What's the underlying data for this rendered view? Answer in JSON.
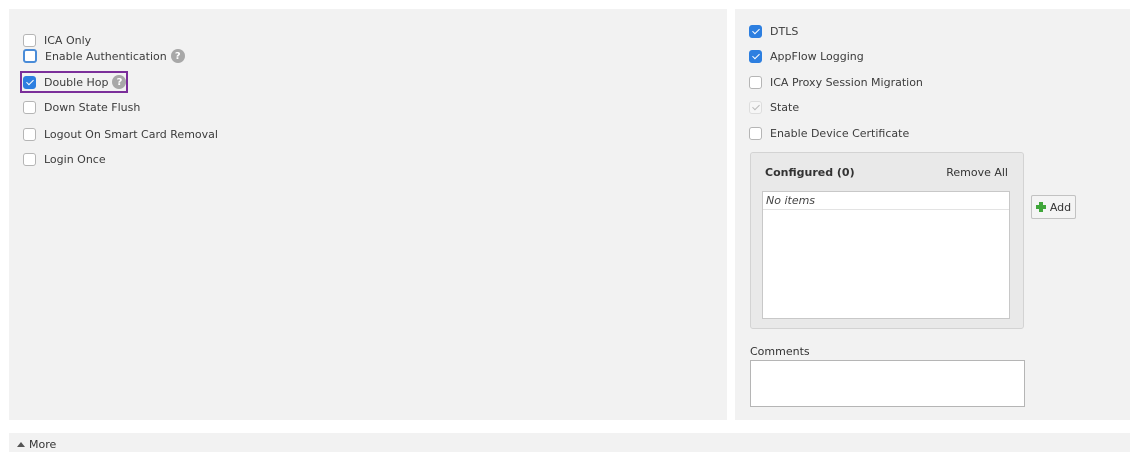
{
  "left_options": [
    {
      "label": "ICA Only",
      "checked": false,
      "help": false,
      "focused": false
    },
    {
      "label": "Enable Authentication",
      "checked": false,
      "help": true,
      "focused": true
    },
    {
      "label": "Double Hop",
      "checked": true,
      "help": true,
      "focused": false,
      "highlighted": true
    },
    {
      "label": "Down State Flush",
      "checked": false,
      "help": false,
      "focused": false
    },
    {
      "label": "Logout On Smart Card Removal",
      "checked": false,
      "help": false,
      "focused": false
    },
    {
      "label": "Login Once",
      "checked": false,
      "help": false,
      "focused": false
    }
  ],
  "right_options": [
    {
      "label": "DTLS",
      "checked": true,
      "disabled": false
    },
    {
      "label": "AppFlow Logging",
      "checked": true,
      "disabled": false
    },
    {
      "label": "ICA Proxy Session Migration",
      "checked": false,
      "disabled": false
    },
    {
      "label": "State",
      "checked": true,
      "disabled": true
    },
    {
      "label": "Enable Device Certificate",
      "checked": false,
      "disabled": false
    }
  ],
  "configured": {
    "title": "Configured (0)",
    "remove_all_label": "Remove All",
    "empty_text": "No items"
  },
  "add_button_label": "Add",
  "comments": {
    "label": "Comments",
    "value": ""
  },
  "more_label": "More",
  "help_icon_glyph": "?",
  "colors": {
    "checkbox_checked": "#2d7fe0",
    "highlight_border": "#7b2f9a",
    "add_icon": "#3fa63a",
    "panel_background": "#f2f2f2"
  }
}
